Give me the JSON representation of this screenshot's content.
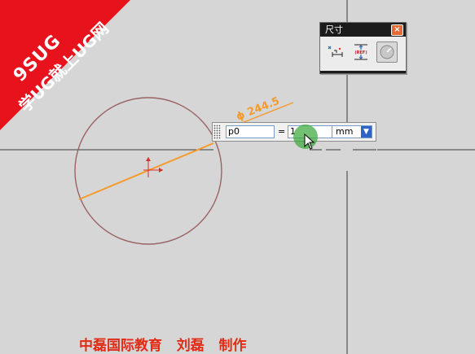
{
  "logo": {
    "brand": "9SUG",
    "slogan": "学UG就上UG网",
    "ribbon_color": "#e8121c"
  },
  "dimension_toolbar": {
    "title": "尺寸",
    "close_label": "×",
    "tools": [
      {
        "name": "auto-dimension-icon"
      },
      {
        "name": "reference-dimension-icon",
        "label": "(REF)"
      },
      {
        "name": "circle-dimension-icon"
      }
    ]
  },
  "sketch": {
    "dimension_label": "ϕ 244.5",
    "accent_color": "#f59a2c",
    "circle_color": "#9a6363",
    "axis_color": "#3a3a3a"
  },
  "parameter_bar": {
    "name": "p0",
    "equals": "=",
    "value": "1",
    "unit": "mm",
    "unit_arrow": "▼"
  },
  "footer": {
    "credit": "中磊国际教育   刘磊   制作",
    "color": "#e12b14"
  }
}
